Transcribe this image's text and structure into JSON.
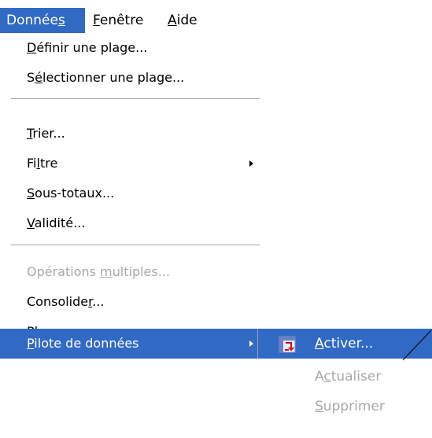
{
  "menubar": {
    "items": [
      {
        "pre": "Donnée",
        "key": "s",
        "post": ""
      },
      {
        "pre": "",
        "key": "F",
        "post": "enêtre"
      },
      {
        "pre": "",
        "key": "A",
        "post": "ide"
      }
    ]
  },
  "menu": {
    "items": [
      {
        "pre": "",
        "key": "D",
        "post": "éfinir une plage..."
      },
      {
        "pre": "S",
        "key": "é",
        "post": "lectionner une plage..."
      },
      {
        "pre": "",
        "key": "T",
        "post": "rier..."
      },
      {
        "pre": "Fi",
        "key": "l",
        "post": "tre"
      },
      {
        "pre": "",
        "key": "S",
        "post": "ous-totaux..."
      },
      {
        "pre": "",
        "key": "V",
        "post": "alidité..."
      },
      {
        "pre": "Opérations ",
        "key": "m",
        "post": "ultiples..."
      },
      {
        "pre": "Consolide",
        "key": "r",
        "post": "..."
      },
      {
        "pre": "Pla",
        "key": "n",
        "post": ""
      },
      {
        "pre": "",
        "key": "P",
        "post": "ilote de données"
      }
    ]
  },
  "submenu": {
    "items": [
      {
        "pre": "",
        "key": "A",
        "post": "ctiver..."
      },
      {
        "pre": "A",
        "key": "c",
        "post": "tualiser"
      },
      {
        "pre": "",
        "key": "S",
        "post": "upprimer"
      }
    ]
  },
  "colors": {
    "highlight": "#316ac5",
    "disabled": "#a8a8a8",
    "separator": "#a0a0a0"
  },
  "icons": {
    "datapilot": "datapilot-icon",
    "submenu_arrow": "triangle-right-icon"
  }
}
